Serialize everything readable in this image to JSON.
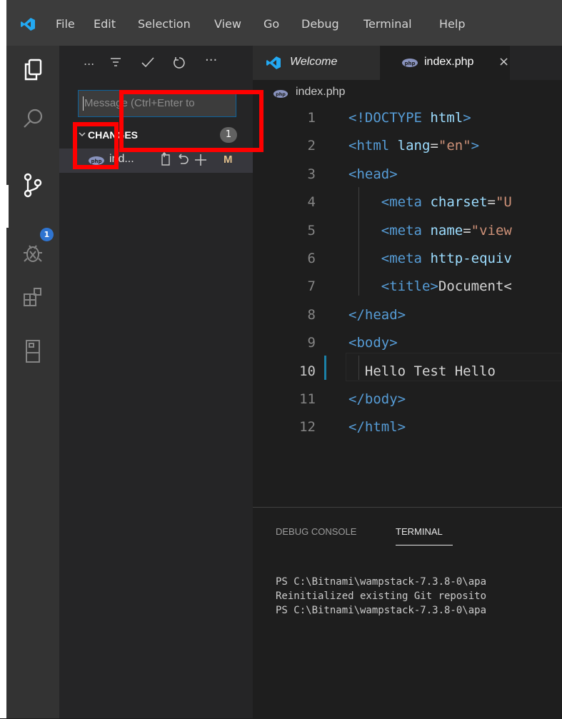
{
  "menu": {
    "items": [
      "File",
      "Edit",
      "Selection",
      "View",
      "Go",
      "Debug",
      "Terminal",
      "Help"
    ]
  },
  "activity": {
    "icons": [
      "explorer-icon",
      "search-icon",
      "source-control-icon",
      "debug-icon",
      "extensions-icon",
      "remote-explorer-icon"
    ],
    "scm_badge": "1"
  },
  "sidebar": {
    "toolbar": [
      "...",
      "filter-icon",
      "check-icon",
      "refresh-icon",
      "···"
    ],
    "toolbar_ellipsis": "...",
    "toolbar_more": "···",
    "commit_placeholder": "Message (Ctrl+Enter to",
    "changes_label": "CHANGES",
    "changes_count": "1",
    "file": {
      "name": "ind...",
      "status": "M"
    }
  },
  "tabs": [
    {
      "label": "Welcome",
      "active": false
    },
    {
      "label": "index.php",
      "active": true,
      "close": "×"
    }
  ],
  "breadcrumb": "index.php",
  "editor": {
    "lines": [
      {
        "n": "1",
        "text": "<!DOCTYPE html>"
      },
      {
        "n": "2",
        "text": "<html lang=\"en\">"
      },
      {
        "n": "3",
        "text": "<head>"
      },
      {
        "n": "4",
        "text": "    <meta charset=\"U"
      },
      {
        "n": "5",
        "text": "    <meta name=\"view"
      },
      {
        "n": "6",
        "text": "    <meta http-equiv"
      },
      {
        "n": "7",
        "text": "    <title>Document<"
      },
      {
        "n": "8",
        "text": "</head>"
      },
      {
        "n": "9",
        "text": "<body>"
      },
      {
        "n": "10",
        "text": "  Hello Test Hello"
      },
      {
        "n": "11",
        "text": "</body>"
      },
      {
        "n": "12",
        "text": "</html>"
      }
    ],
    "current_line": "10"
  },
  "panel": {
    "tabs": [
      "DEBUG CONSOLE",
      "TERMINAL"
    ],
    "active_tab": "TERMINAL",
    "terminal_lines": [
      "PS C:\\Bitnami\\wampstack-7.3.8-0\\apa",
      "Reinitialized existing Git reposito",
      "PS C:\\Bitnami\\wampstack-7.3.8-0\\apa"
    ]
  },
  "colors": {
    "accent": "#0e639c",
    "annotation": "#ff0000",
    "badge": "#2f74d0",
    "modified": "#e2c08d"
  }
}
